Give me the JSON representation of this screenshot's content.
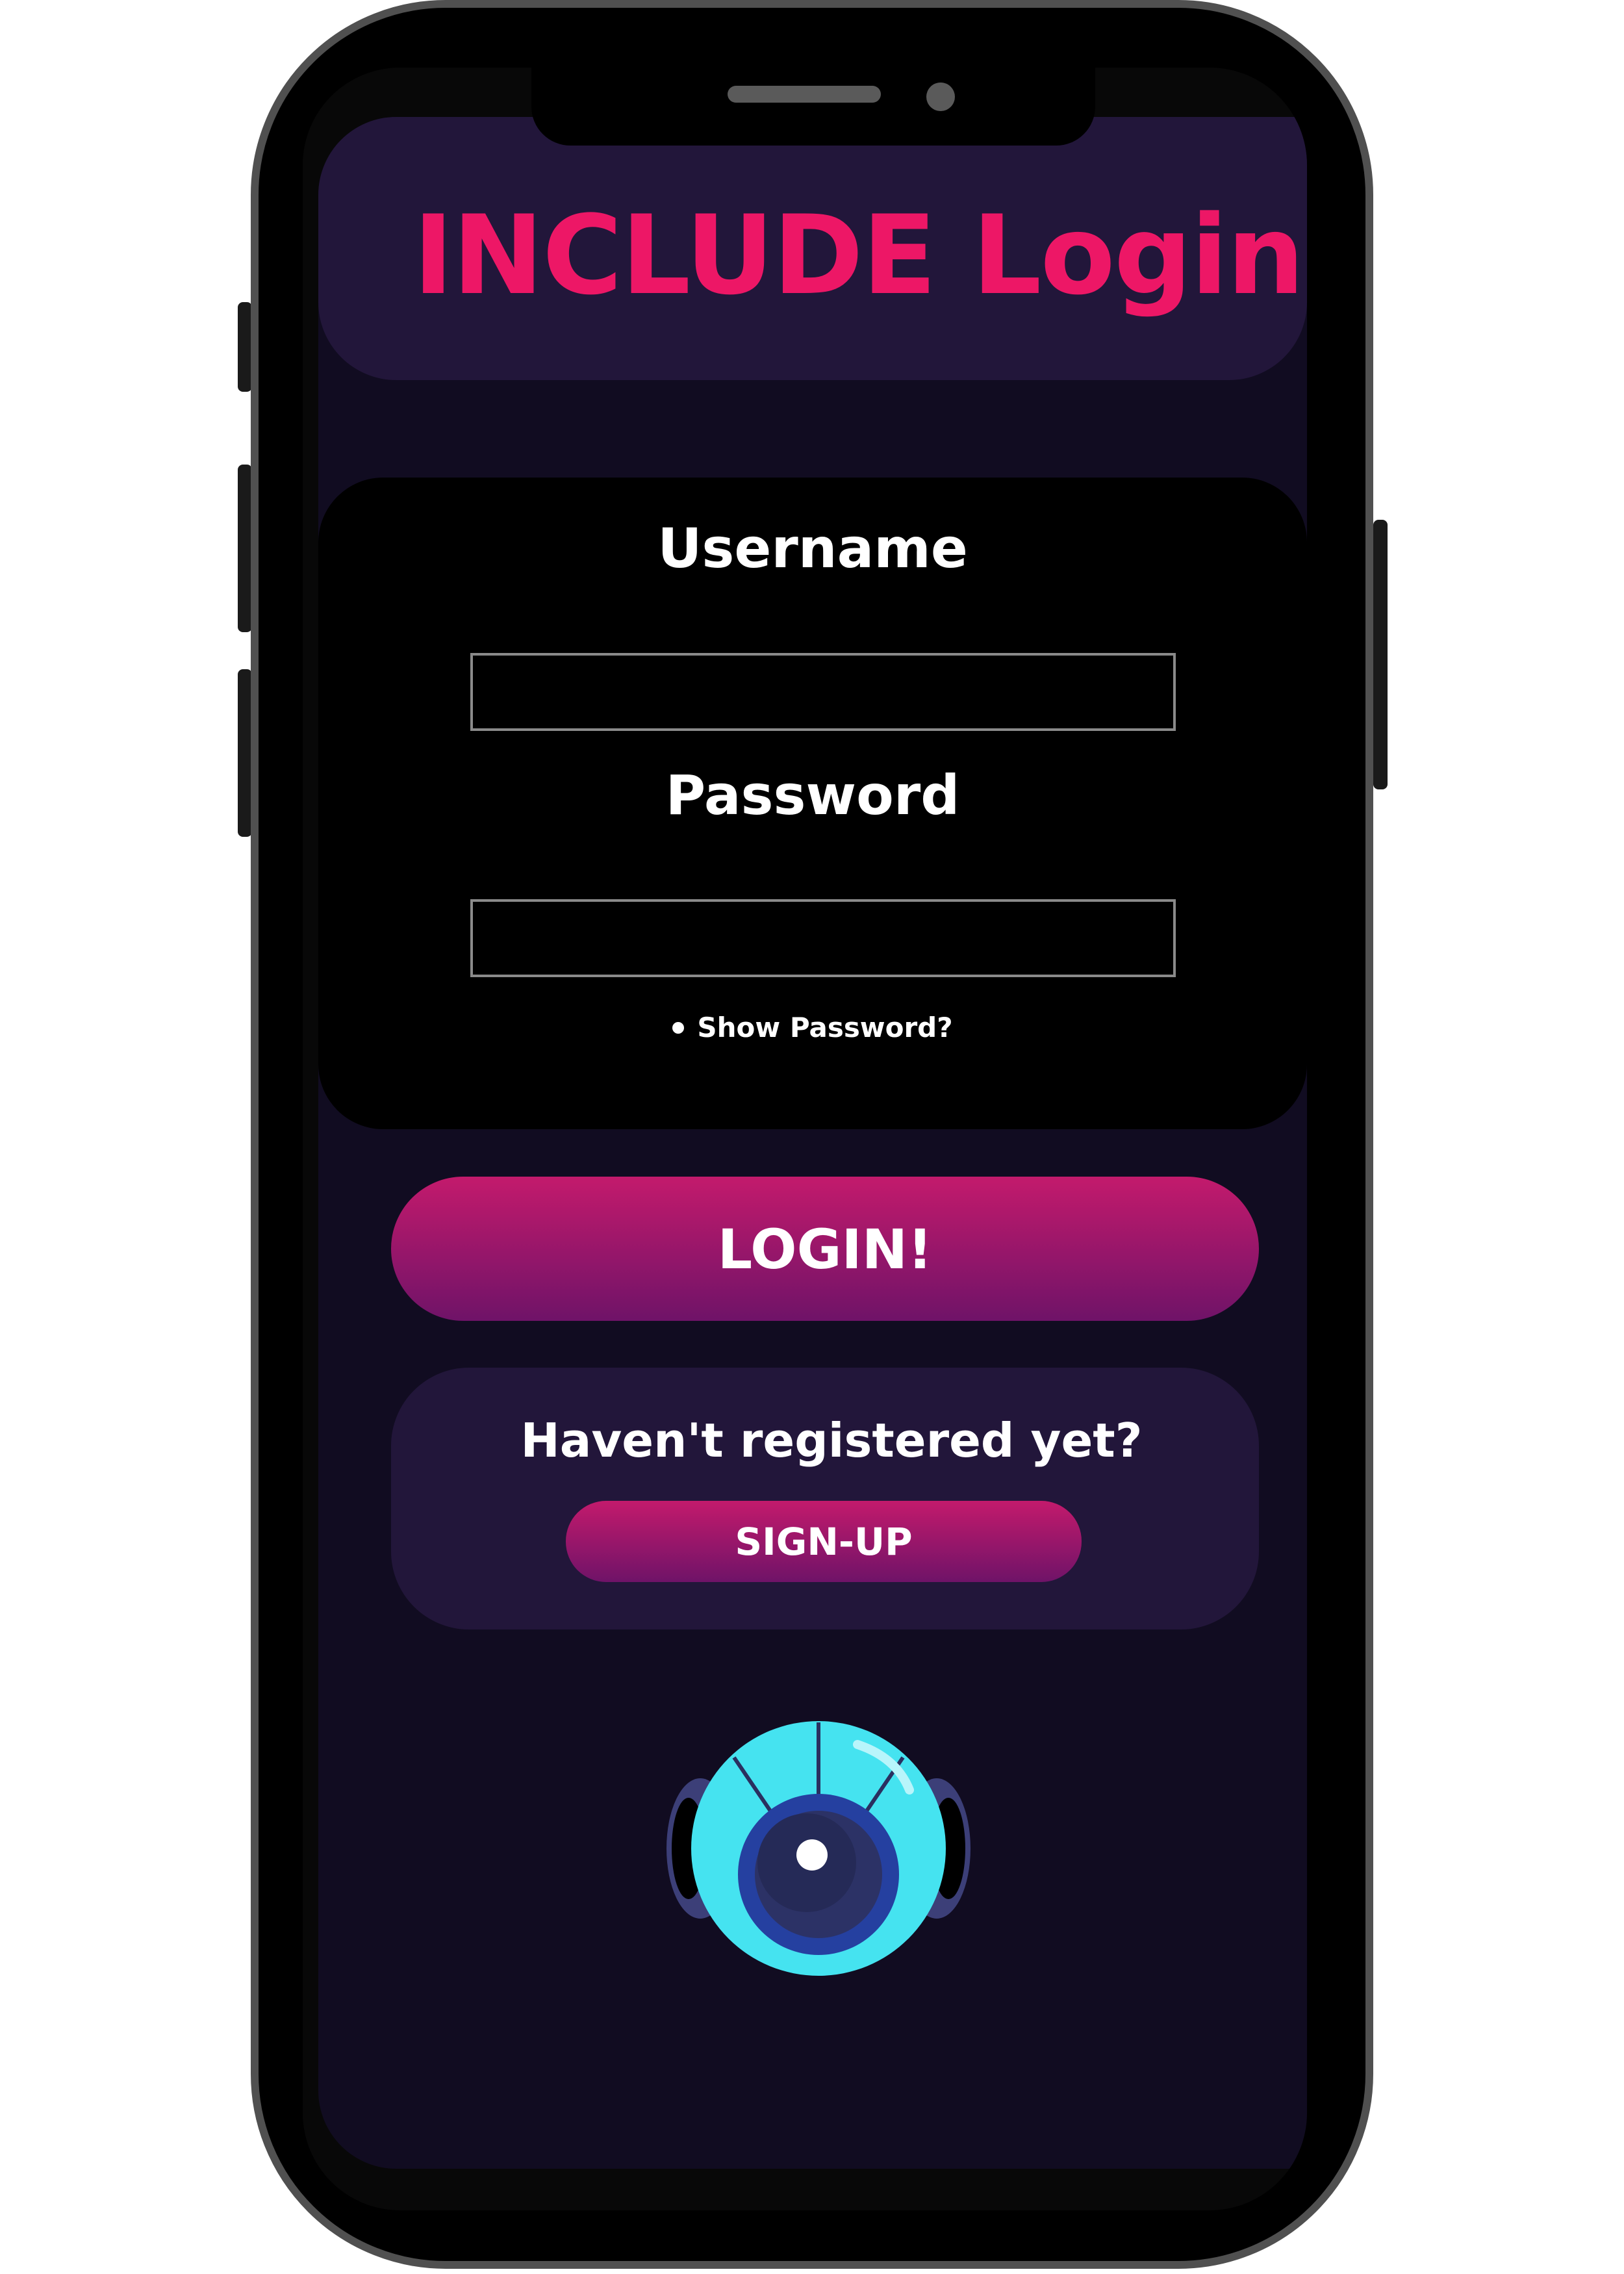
{
  "header": {
    "title": "INCLUDE Login"
  },
  "form": {
    "username_label": "Username",
    "username_value": "",
    "password_label": "Password",
    "password_value": "",
    "show_password_label": "Show Password?"
  },
  "actions": {
    "login_label": "LOGIN!"
  },
  "register": {
    "prompt": "Haven't registered yet?",
    "signup_label": "SIGN-UP"
  },
  "mascot": {
    "icon": "robot-mascot-icon"
  },
  "colors": {
    "background": "#110c21",
    "card_purple": "#22163a",
    "title_pink": "#ed1766",
    "button_gradient_top": "#c31a6c",
    "button_gradient_bottom": "#6f1368",
    "robot_cyan": "#45e3f0",
    "robot_blue": "#2540a0"
  }
}
